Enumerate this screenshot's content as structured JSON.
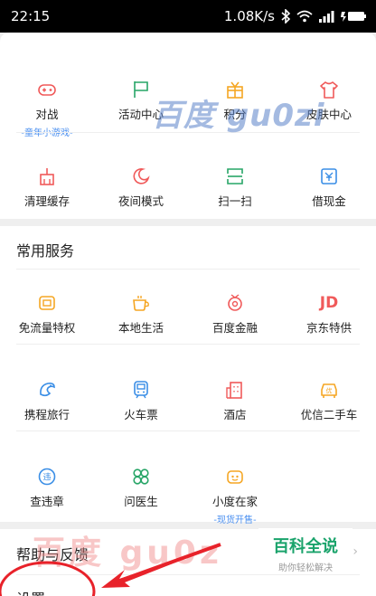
{
  "status_bar": {
    "time": "22:15",
    "net_speed": "1.08K/s"
  },
  "tools": {
    "row1": [
      {
        "label": "对战",
        "sub": "-童年小游戏-",
        "icon": "gamepad-icon",
        "color": "#f05a5a"
      },
      {
        "label": "活动中心",
        "sub": "",
        "icon": "flag-icon",
        "color": "#27a567"
      },
      {
        "label": "积分",
        "sub": "",
        "icon": "gift-icon",
        "color": "#f5a623"
      },
      {
        "label": "皮肤中心",
        "sub": "",
        "icon": "shirt-icon",
        "color": "#f05a5a"
      }
    ],
    "row2": [
      {
        "label": "清理缓存",
        "sub": "",
        "icon": "broom-icon",
        "color": "#f05a5a"
      },
      {
        "label": "夜间模式",
        "sub": "",
        "icon": "moon-icon",
        "color": "#f05a5a"
      },
      {
        "label": "扫一扫",
        "sub": "",
        "icon": "scan-icon",
        "color": "#27a567"
      },
      {
        "label": "借现金",
        "sub": "",
        "icon": "cash-icon",
        "color": "#3a8ee6"
      }
    ]
  },
  "services": {
    "title": "常用服务",
    "row1": [
      {
        "label": "免流量特权",
        "sub": "",
        "icon": "data-card-icon",
        "color": "#f5a623"
      },
      {
        "label": "本地生活",
        "sub": "",
        "icon": "coffee-cup-icon",
        "color": "#f5a623"
      },
      {
        "label": "百度金融",
        "sub": "",
        "icon": "finance-icon",
        "color": "#f05a5a"
      },
      {
        "label": "京东特供",
        "sub": "",
        "icon": "jd-logo-icon",
        "color": "#f05a5a",
        "glyph": "JD"
      }
    ],
    "row2": [
      {
        "label": "携程旅行",
        "sub": "",
        "icon": "dolphin-icon",
        "color": "#3a8ee6"
      },
      {
        "label": "火车票",
        "sub": "",
        "icon": "train-icon",
        "color": "#3a8ee6"
      },
      {
        "label": "酒店",
        "sub": "",
        "icon": "building-icon",
        "color": "#f05a5a"
      },
      {
        "label": "优信二手车",
        "sub": "",
        "icon": "car-icon",
        "color": "#f5a623"
      }
    ],
    "row3": [
      {
        "label": "查违章",
        "sub": "",
        "icon": "violation-icon",
        "color": "#3a8ee6"
      },
      {
        "label": "问医生",
        "sub": "",
        "icon": "clover-icon",
        "color": "#27a567"
      },
      {
        "label": "小度在家",
        "sub": "-现货开售-",
        "icon": "smart-speaker-icon",
        "color": "#f5a623"
      }
    ]
  },
  "help": {
    "label": "帮助与反馈",
    "arrow": "›"
  },
  "settings": {
    "label": "设置"
  },
  "watermark": {
    "top": "百度 gu0zi",
    "bottom": "百度 gu0z"
  },
  "badge": {
    "title": "百科全说",
    "subtitle": "助你轻松解决"
  }
}
